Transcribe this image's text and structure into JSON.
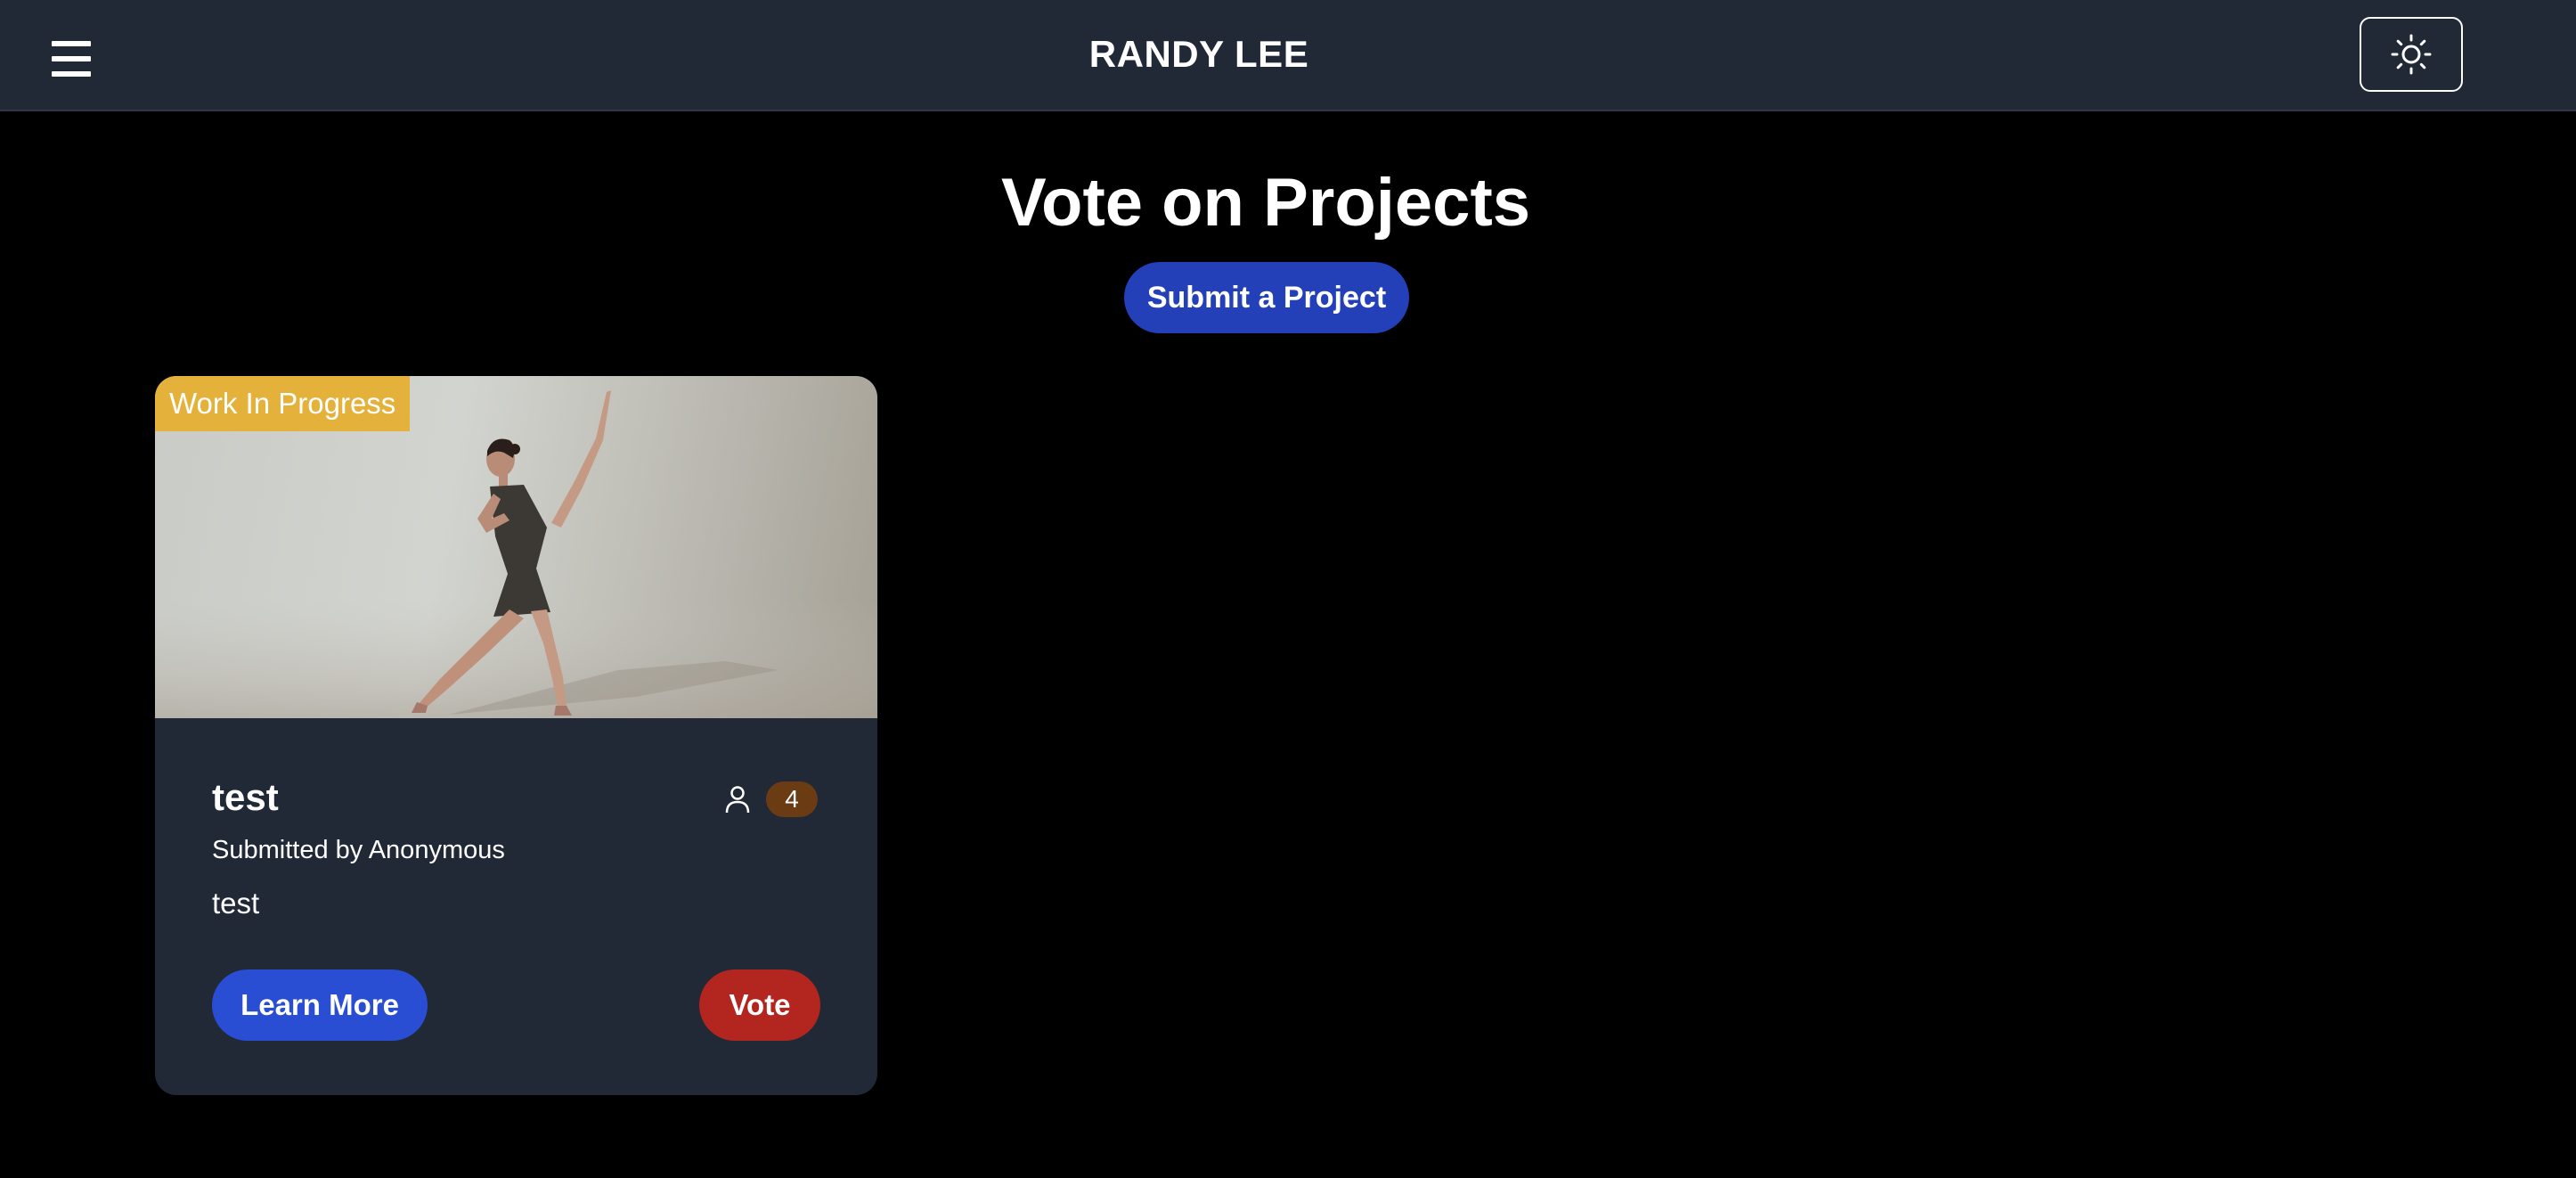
{
  "header": {
    "brand": "RANDY LEE",
    "menu_icon": "hamburger-menu-icon",
    "theme_icon": "sun-icon"
  },
  "main": {
    "title": "Vote on Projects",
    "submit_label": "Submit a Project"
  },
  "projects": [
    {
      "status": "Work In Progress",
      "image_subject": "ballet dancer",
      "title": "test",
      "submitted_by": "Submitted by Anonymous",
      "description": "test",
      "votes": "4",
      "votes_icon": "user-icon",
      "learn_more_label": "Learn More",
      "vote_label": "Vote"
    }
  ],
  "colors": {
    "navbar": "#212836",
    "background": "#000000",
    "primary_button": "#2340b8",
    "learn_button": "#2a4ed3",
    "vote_button": "#b3251f",
    "status_badge": "#e4b13b",
    "vote_count_badge": "#6b3b14"
  }
}
